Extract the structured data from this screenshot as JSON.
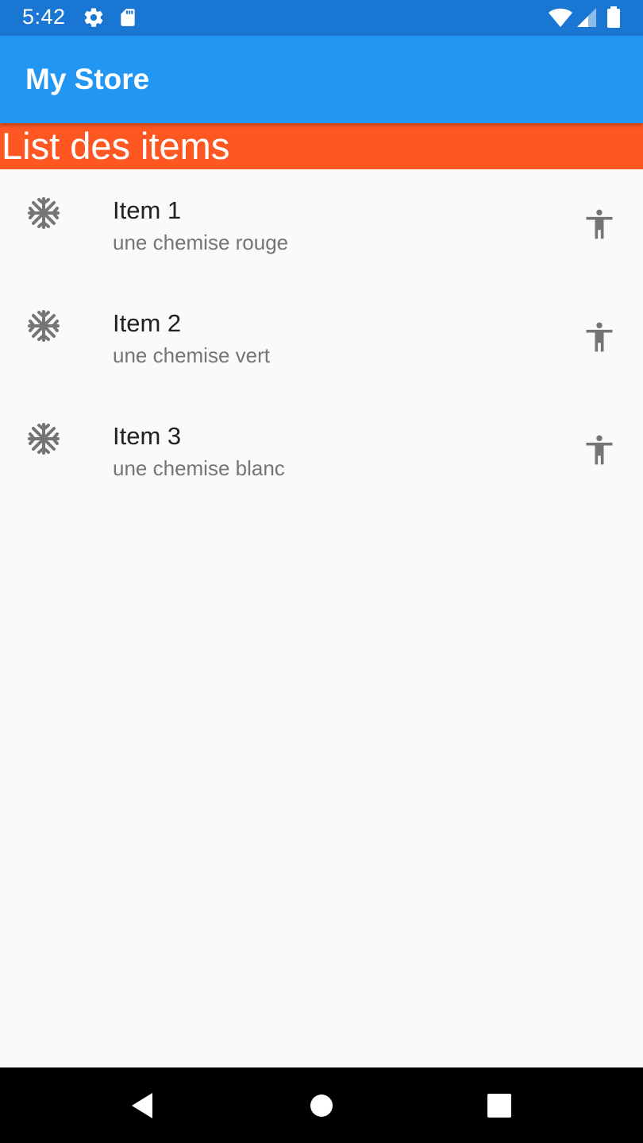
{
  "status_bar": {
    "time": "5:42",
    "icons": [
      "settings-icon",
      "sd-card-icon",
      "wifi-icon",
      "cell-signal-icon",
      "battery-icon"
    ],
    "background": "#1976d2"
  },
  "app_bar": {
    "title": "My Store",
    "background": "#2196f3"
  },
  "list_header": {
    "text": "List des items",
    "background": "#ff5722"
  },
  "items": [
    {
      "title": "Item 1",
      "subtitle": "une chemise rouge",
      "leading_icon": "snowflake-icon",
      "trailing_icon": "accessibility-icon"
    },
    {
      "title": "Item 2",
      "subtitle": "une chemise vert",
      "leading_icon": "snowflake-icon",
      "trailing_icon": "accessibility-icon"
    },
    {
      "title": "Item 3",
      "subtitle": "une chemise blanc",
      "leading_icon": "snowflake-icon",
      "trailing_icon": "accessibility-icon"
    }
  ],
  "nav_bar": {
    "buttons": [
      "back-icon",
      "home-icon",
      "recents-icon"
    ]
  }
}
